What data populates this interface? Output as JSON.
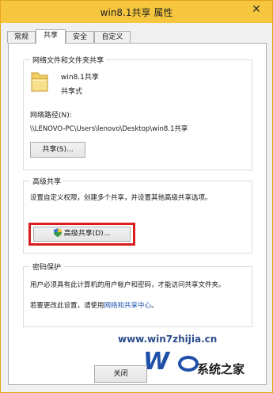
{
  "window": {
    "title": "win8.1共享 属性",
    "close_symbol": "✕"
  },
  "tabs": [
    "常规",
    "共享",
    "安全",
    "自定义"
  ],
  "network_share": {
    "legend": "网络文件和文件夹共享",
    "folder_name": "win8.1共享",
    "status": "共享式",
    "path_label": "网络路径(N):",
    "path_value": "\\\\LENOVO-PC\\Users\\lenovo\\Desktop\\win8.1共享",
    "share_button": "共享(S)..."
  },
  "advanced_share": {
    "legend": "高级共享",
    "description": "设置自定义权限，创建多个共享，并设置其他高级共享选项。",
    "button": "高级共享(D)..."
  },
  "password": {
    "legend": "密码保护",
    "description": "用户必须具有此计算机的用户帐户和密码，才能访问共享文件夹。",
    "change_prefix": "若要更改此设置，请使用",
    "link": "网络和共享中心",
    "change_suffix": "。"
  },
  "footer": {
    "close_button": "关闭"
  },
  "watermark": {
    "url": "www.win7zhijia.cn",
    "logo_text": "系统之家"
  },
  "colors": {
    "title_bar": "#f6c73e",
    "highlight_box": "#d81e1e",
    "link": "#1a56b0"
  }
}
